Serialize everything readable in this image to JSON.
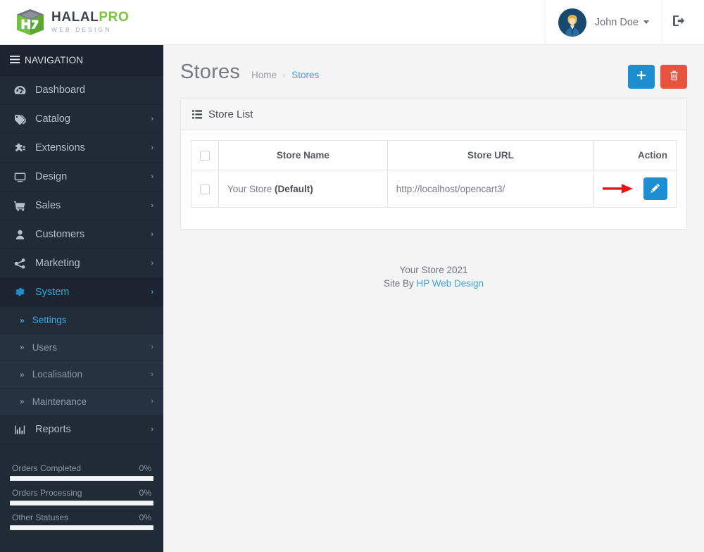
{
  "brand": {
    "name_primary": "HALAL",
    "name_accent": "PRO",
    "tagline": "WEB DESIGN",
    "accent_color": "#7cc242",
    "primary_color": "#3b4450"
  },
  "topbar": {
    "user_name": "John Doe",
    "avatar_icon": "user-avatar",
    "dropdown_icon": "chevron-down-icon",
    "logout_icon": "sign-out-icon"
  },
  "sidebar": {
    "nav_header": "NAVIGATION",
    "nav_header_icon": "hamburger-icon",
    "items": [
      {
        "label": "Dashboard",
        "icon": "dashboard-icon",
        "has_caret": false,
        "state": "normal"
      },
      {
        "label": "Catalog",
        "icon": "tag-icon",
        "has_caret": true,
        "state": "normal"
      },
      {
        "label": "Extensions",
        "icon": "puzzle-icon",
        "has_caret": true,
        "state": "normal"
      },
      {
        "label": "Design",
        "icon": "monitor-icon",
        "has_caret": true,
        "state": "normal"
      },
      {
        "label": "Sales",
        "icon": "cart-icon",
        "has_caret": true,
        "state": "normal"
      },
      {
        "label": "Customers",
        "icon": "user-icon",
        "has_caret": true,
        "state": "normal"
      },
      {
        "label": "Marketing",
        "icon": "share-icon",
        "has_caret": true,
        "state": "normal"
      },
      {
        "label": "System",
        "icon": "gear-icon",
        "has_caret": true,
        "state": "open"
      }
    ],
    "submenu": [
      {
        "label": "Settings",
        "has_caret": false,
        "state": "active"
      },
      {
        "label": "Users",
        "has_caret": true,
        "state": "normal"
      },
      {
        "label": "Localisation",
        "has_caret": true,
        "state": "normal"
      },
      {
        "label": "Maintenance",
        "has_caret": true,
        "state": "normal"
      }
    ],
    "reports": {
      "label": "Reports",
      "icon": "bar-chart-icon",
      "has_caret": true
    },
    "stats": [
      {
        "label": "Orders Completed",
        "percent": "0%",
        "value": 0
      },
      {
        "label": "Orders Processing",
        "percent": "0%",
        "value": 0
      },
      {
        "label": "Other Statuses",
        "percent": "0%",
        "value": 0
      }
    ]
  },
  "page": {
    "title": "Stores",
    "breadcrumb": {
      "home": "Home",
      "separator": "›",
      "current": "Stores"
    },
    "actions": {
      "add_label": "+",
      "add_icon": "plus-icon",
      "add_color": "#1d8fd1",
      "delete_icon": "trash-icon",
      "delete_color": "#e8533e"
    }
  },
  "panel": {
    "title": "Store List",
    "icon": "list-icon"
  },
  "table": {
    "columns": [
      "",
      "Store Name",
      "Store URL",
      "Action"
    ],
    "rows": [
      {
        "checked": false,
        "store_name": "Your Store ",
        "store_name_suffix": "(Default)",
        "store_url": "http://localhost/opencart3/",
        "edit_icon": "pencil-icon",
        "annotation": "red-arrow-pointing-right"
      }
    ]
  },
  "footer": {
    "line1": "Your Store 2021",
    "line2_prefix": "Site By ",
    "line2_link": "HP Web Design"
  }
}
